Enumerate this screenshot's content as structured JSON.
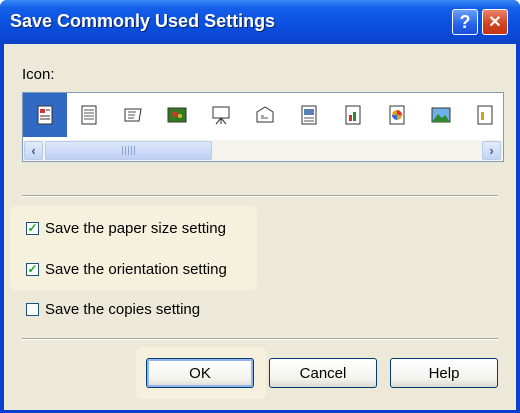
{
  "window": {
    "title": "Save Commonly Used Settings",
    "help_glyph": "?",
    "close_glyph": "✕"
  },
  "icon_section": {
    "label": "Icon:",
    "icons": [
      {
        "name": "document-text-image-icon",
        "selected": true
      },
      {
        "name": "document-lines-icon",
        "selected": false
      },
      {
        "name": "document-folded-icon",
        "selected": false
      },
      {
        "name": "landscape-photo-icon",
        "selected": false
      },
      {
        "name": "presentation-easel-icon",
        "selected": false
      },
      {
        "name": "envelope-icon",
        "selected": false
      },
      {
        "name": "document-picture-icon",
        "selected": false
      },
      {
        "name": "document-chart-icon",
        "selected": false
      },
      {
        "name": "document-color-wheel-icon",
        "selected": false
      },
      {
        "name": "mountain-photo-icon",
        "selected": false
      },
      {
        "name": "document-partial-icon",
        "selected": false
      }
    ],
    "scrollbar_grip": "III"
  },
  "options": {
    "paper_size": {
      "label": "Save the paper size setting",
      "checked": true
    },
    "orientation": {
      "label": "Save the orientation setting",
      "checked": true
    },
    "copies": {
      "label": "Save the copies setting",
      "checked": false
    }
  },
  "buttons": {
    "ok": "OK",
    "cancel": "Cancel",
    "help": "Help"
  },
  "colors": {
    "titlebar": "#0b4fdf",
    "selection": "#316ac5",
    "highlight": "#f6f1dd",
    "check": "#21a121"
  }
}
